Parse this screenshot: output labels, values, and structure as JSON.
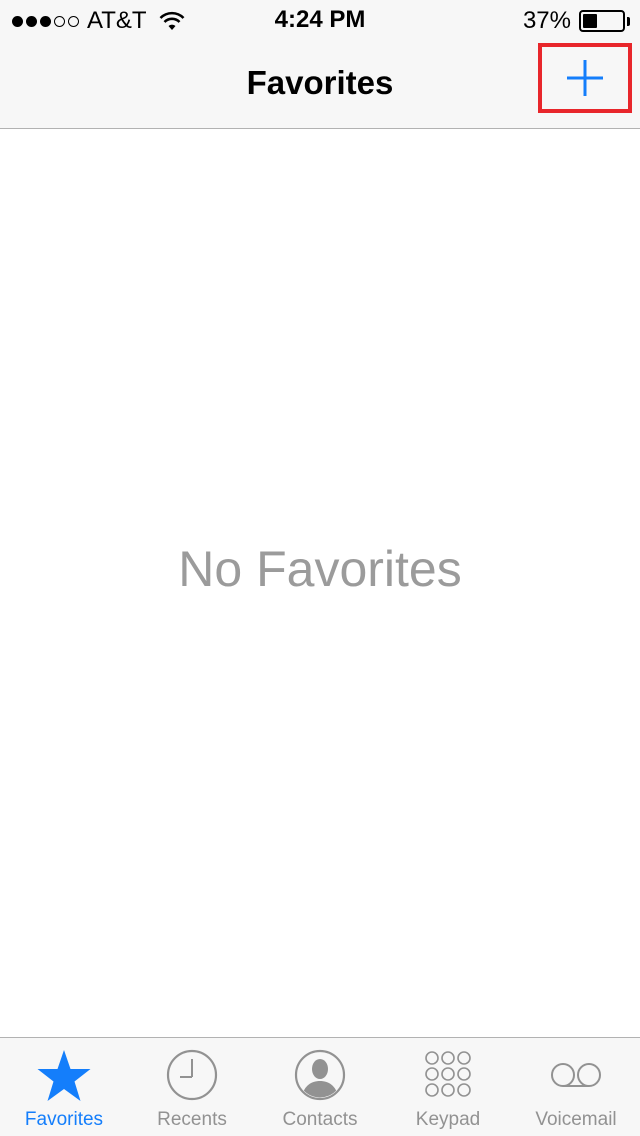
{
  "status_bar": {
    "carrier": "AT&T",
    "signal_bars": 3,
    "signal_total": 5,
    "time": "4:24 PM",
    "battery_percent": "37%",
    "battery_level": 0.37
  },
  "nav": {
    "title": "Favorites",
    "add_icon": "plus-icon"
  },
  "main": {
    "empty_message": "No Favorites"
  },
  "tabs": [
    {
      "label": "Favorites",
      "icon": "star-icon",
      "active": true
    },
    {
      "label": "Recents",
      "icon": "clock-icon",
      "active": false
    },
    {
      "label": "Contacts",
      "icon": "contact-icon",
      "active": false
    },
    {
      "label": "Keypad",
      "icon": "keypad-icon",
      "active": false
    },
    {
      "label": "Voicemail",
      "icon": "voicemail-icon",
      "active": false
    }
  ],
  "colors": {
    "accent": "#147efb",
    "highlight": "#e8262b",
    "inactive": "#929292",
    "empty_text": "#9b9b9b"
  }
}
